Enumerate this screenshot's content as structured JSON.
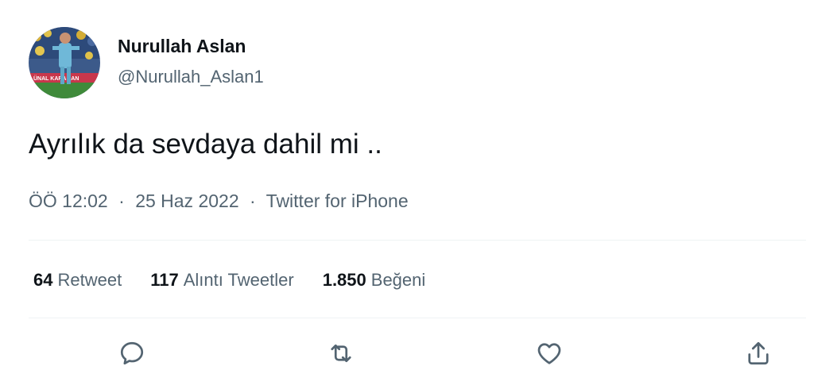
{
  "author": {
    "display_name": "Nurullah Aslan",
    "handle": "@Nurullah_Aslan1",
    "avatar_banner_text": "ÜNAL KARAMAN"
  },
  "tweet": {
    "text": "Ayrılık da sevdaya dahil mi .."
  },
  "meta": {
    "time": "ÖÖ 12:02",
    "separator": "·",
    "date": "25 Haz 2022",
    "source": "Twitter for iPhone"
  },
  "stats": {
    "retweets": {
      "count": "64",
      "label": "Retweet"
    },
    "quotes": {
      "count": "117",
      "label": "Alıntı Tweetler"
    },
    "likes": {
      "count": "1.850",
      "label": "Beğeni"
    }
  },
  "actions": {
    "icons": [
      "reply-icon",
      "retweet-icon",
      "like-icon",
      "share-icon"
    ]
  },
  "colors": {
    "text_primary": "#0f1419",
    "text_secondary": "#536471",
    "divider": "#eff3f4",
    "icon": "#536471"
  }
}
